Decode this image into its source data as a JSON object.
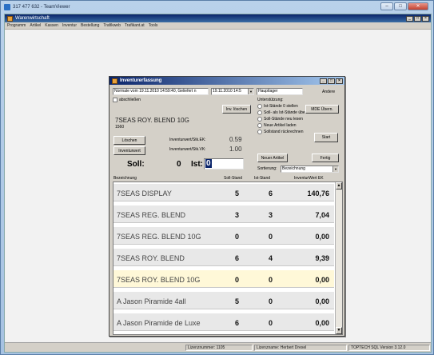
{
  "teamviewer": {
    "title": "317 477 632 - TeamViewer"
  },
  "app": {
    "title": "Warenwirtschaft",
    "menu": [
      "Programm",
      "Artikel",
      "Kassen",
      "Inventur",
      "Bestellung",
      "Trafikweb",
      "Trafikant.at",
      "Tools"
    ]
  },
  "dialog": {
    "title": "Inventurerfassung",
    "inventory_select": "Normale vom 19.11.2010 14:59:40, Geliefert n",
    "date_value": "19.11.2010 14:5",
    "location_value": "Hauptlager",
    "andere_label": "Andere",
    "abschliessen_label": "abschließen",
    "inv_loeschen_label": "Inv. löschen",
    "article_name": "7SEAS ROY. BLEND 10G",
    "article_number": "1560",
    "loeschen_label": "Löschen",
    "inventurwert_label": "Inventurwert",
    "ek_label": "Inventurwert/Stk.EK:",
    "ek_value": "0.59",
    "vk_label": "Inventurwert/Stk.VK:",
    "vk_value": "1.00",
    "soll_label": "Soll:",
    "soll_value": "0",
    "ist_label": "Ist:",
    "ist_value": "0",
    "unterstuetzung_label": "Unterstützung:",
    "options": [
      "Ist-Stände 0 stellen",
      "Soll- als Ist-Stände übernehmen",
      "Soll-Stände neu lesen",
      "Neue Artikel laden",
      "Sollstand rückrechnen"
    ],
    "mde_label": "MDE Übern.",
    "start_label": "Start",
    "neuer_artikel_label": "Neuer Artikel",
    "fertig_label": "Fertig",
    "sortierung_label": "Sortierung:",
    "sortierung_value": "Bezeichnung",
    "columns": [
      "Bezeichnung",
      "Soll-Stand",
      "Ist-Stand",
      "InventurWert EK"
    ],
    "rows": [
      {
        "name": "7SEAS DISPLAY",
        "soll": "5",
        "ist": "6",
        "wert": "140,76"
      },
      {
        "name": "7SEAS REG. BLEND",
        "soll": "3",
        "ist": "3",
        "wert": "7,04"
      },
      {
        "name": "7SEAS REG. BLEND 10G",
        "soll": "0",
        "ist": "0",
        "wert": "0,00"
      },
      {
        "name": "7SEAS ROY. BLEND",
        "soll": "6",
        "ist": "4",
        "wert": "9,39"
      },
      {
        "name": "7SEAS ROY. BLEND 10G",
        "soll": "0",
        "ist": "0",
        "wert": "0,00"
      },
      {
        "name": "A Jason Piramide 4all",
        "soll": "5",
        "ist": "0",
        "wert": "0,00"
      },
      {
        "name": "A Jason Piramide de Luxe",
        "soll": "6",
        "ist": "0",
        "wert": "0,00"
      }
    ],
    "selected_row": 4
  },
  "statusbar": {
    "lizenznummer": "Lizenznummer: 1105",
    "lizenzname": "Lizenzname: Herbert Drexel",
    "version": "TOPTECH SQL Version 3.12.0"
  },
  "colors": {
    "title_blue": "#0a246a",
    "selected_row": "#fff8d8",
    "row_bg": "#e8e8e8"
  }
}
